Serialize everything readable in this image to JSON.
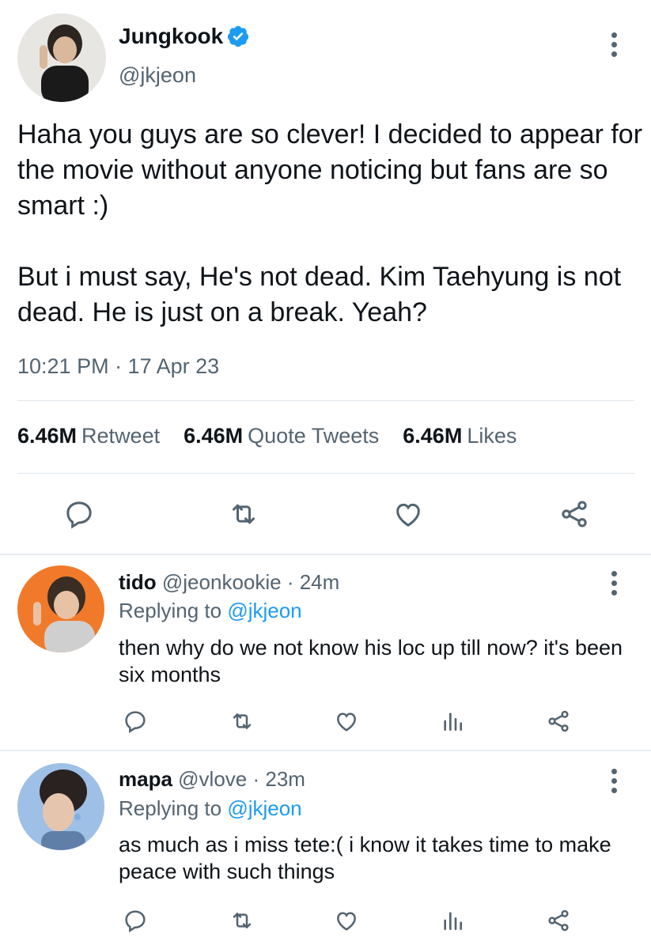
{
  "tweet": {
    "author_name": "Jungkook",
    "author_handle": "@jkjeon",
    "verified_icon": "verified-badge-icon",
    "text_paragraphs": [
      "Haha you guys are so clever! I decided to appear for the movie without anyone noticing but fans are so smart :)",
      "But i must say, He's not dead. Kim Taehyung is not dead. He is just on a break. Yeah?"
    ],
    "timestamp": "10:21 PM · 17 Apr 23",
    "stats": {
      "retweets_count": "6.46M",
      "retweets_label": "Retweet",
      "quotes_count": "6.46M",
      "quotes_label": "Quote Tweets",
      "likes_count": "6.46M",
      "likes_label": "Likes"
    },
    "actions": [
      "reply-icon",
      "retweet-icon",
      "like-icon",
      "share-icon"
    ]
  },
  "replies": [
    {
      "name": "tido",
      "handle": "@jeonkookie",
      "time": "· 24m",
      "replying_label": "Replying to",
      "replying_to": "@jkjeon",
      "text": "then why do we not know his loc up till now? it's been six months",
      "actions": [
        "reply-icon",
        "retweet-icon",
        "like-icon",
        "analytics-icon",
        "share-icon"
      ]
    },
    {
      "name": "mapa",
      "handle": "@vlove",
      "time": "· 23m",
      "replying_label": "Replying to",
      "replying_to": "@jkjeon",
      "text": "as much as i miss tete:( i know it takes time to make peace with such things",
      "actions": [
        "reply-icon",
        "retweet-icon",
        "like-icon",
        "analytics-icon",
        "share-icon"
      ]
    }
  ],
  "colors": {
    "accent": "#1d9bf0",
    "text_primary": "#0f1419",
    "text_secondary": "#536471",
    "divider": "#e1e8ed"
  }
}
